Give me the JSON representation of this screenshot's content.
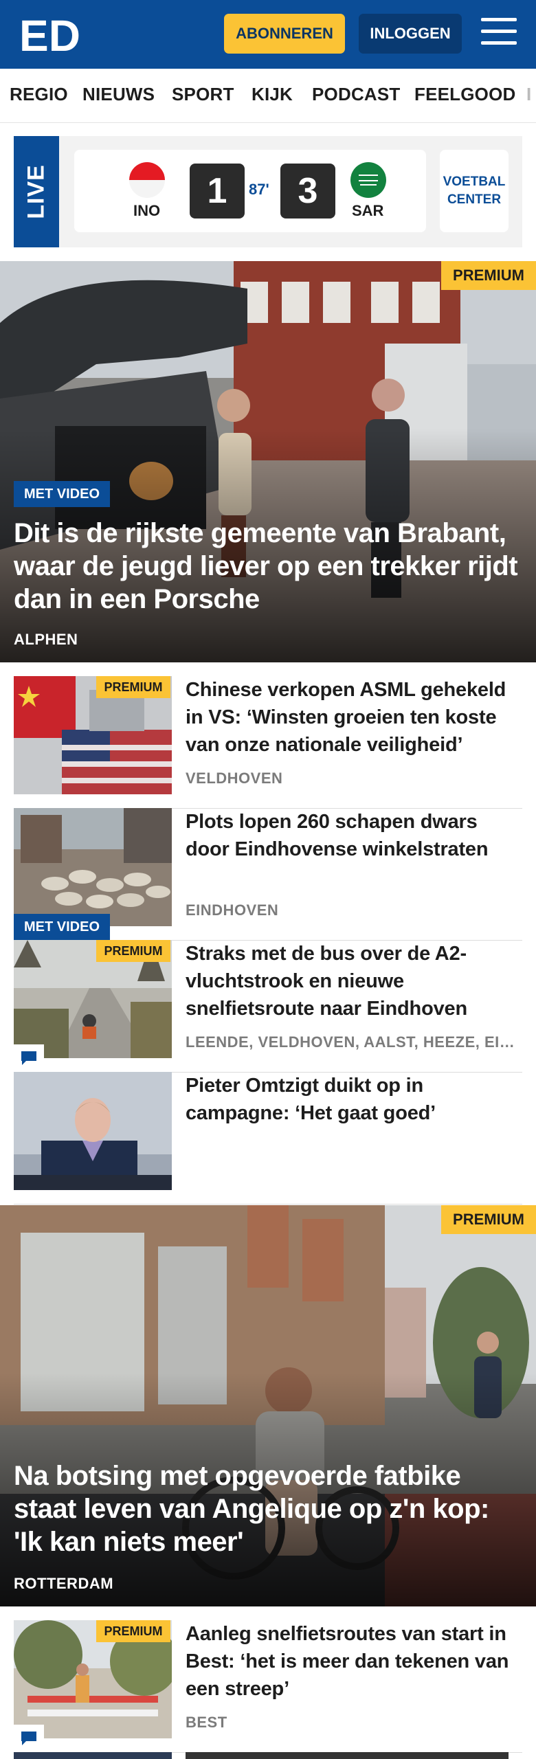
{
  "header": {
    "logo_text": "ED",
    "subscribe_label": "ABONNEREN",
    "login_label": "INLOGGEN",
    "colors": {
      "brand": "#0b4d97",
      "accent": "#fbc335"
    }
  },
  "nav": {
    "items": [
      "REGIO",
      "NIEUWS",
      "SPORT",
      "KIJK",
      "PODCAST",
      "FEELGOOD",
      "I"
    ]
  },
  "live": {
    "label": "LIVE",
    "home_team": "INO",
    "home_score": "1",
    "minute": "87'",
    "away_score": "3",
    "away_team": "SAR",
    "center_line1": "VOETBAL",
    "center_line2": "CENTER"
  },
  "hero1": {
    "premium": "PREMIUM",
    "video": "MET VIDEO",
    "title": "Dit is de rijkste gemeente van Brabant, waar de jeugd liever op een trekker rijdt dan in een Porsche",
    "location": "ALPHEN"
  },
  "articles": [
    {
      "title": "Chinese verkopen ASML gehekeld in VS: ‘Winsten groeien ten koste van onze nationale veiligheid’",
      "location": "VELDHOVEN",
      "premium": "PREMIUM"
    },
    {
      "title": "Plots lopen 260 schapen dwars door Eindhovense winkelstraten",
      "location": "EINDHOVEN",
      "video": "MET VIDEO"
    },
    {
      "title": "Straks met de bus over de A2-vluchtstrook en nieuwe snelfietsroute naar Eindhoven",
      "location": "LEENDE, VELDHOVEN, AALST, HEEZE, EINDHOVEN",
      "premium": "PREMIUM"
    },
    {
      "title": "Pieter Omtzigt duikt op in campagne: ‘Het gaat goed’",
      "location": ""
    }
  ],
  "hero2": {
    "premium": "PREMIUM",
    "title": "Na botsing met opgevoerde fatbike staat leven van Angelique op z'n kop: 'Ik kan niets meer'",
    "location": "ROTTERDAM"
  },
  "articles2": [
    {
      "title": "Aanleg snelfietsroutes van start in Best: ‘het is meer dan tekenen van een streep’",
      "location": "BEST",
      "premium": "PREMIUM"
    }
  ]
}
